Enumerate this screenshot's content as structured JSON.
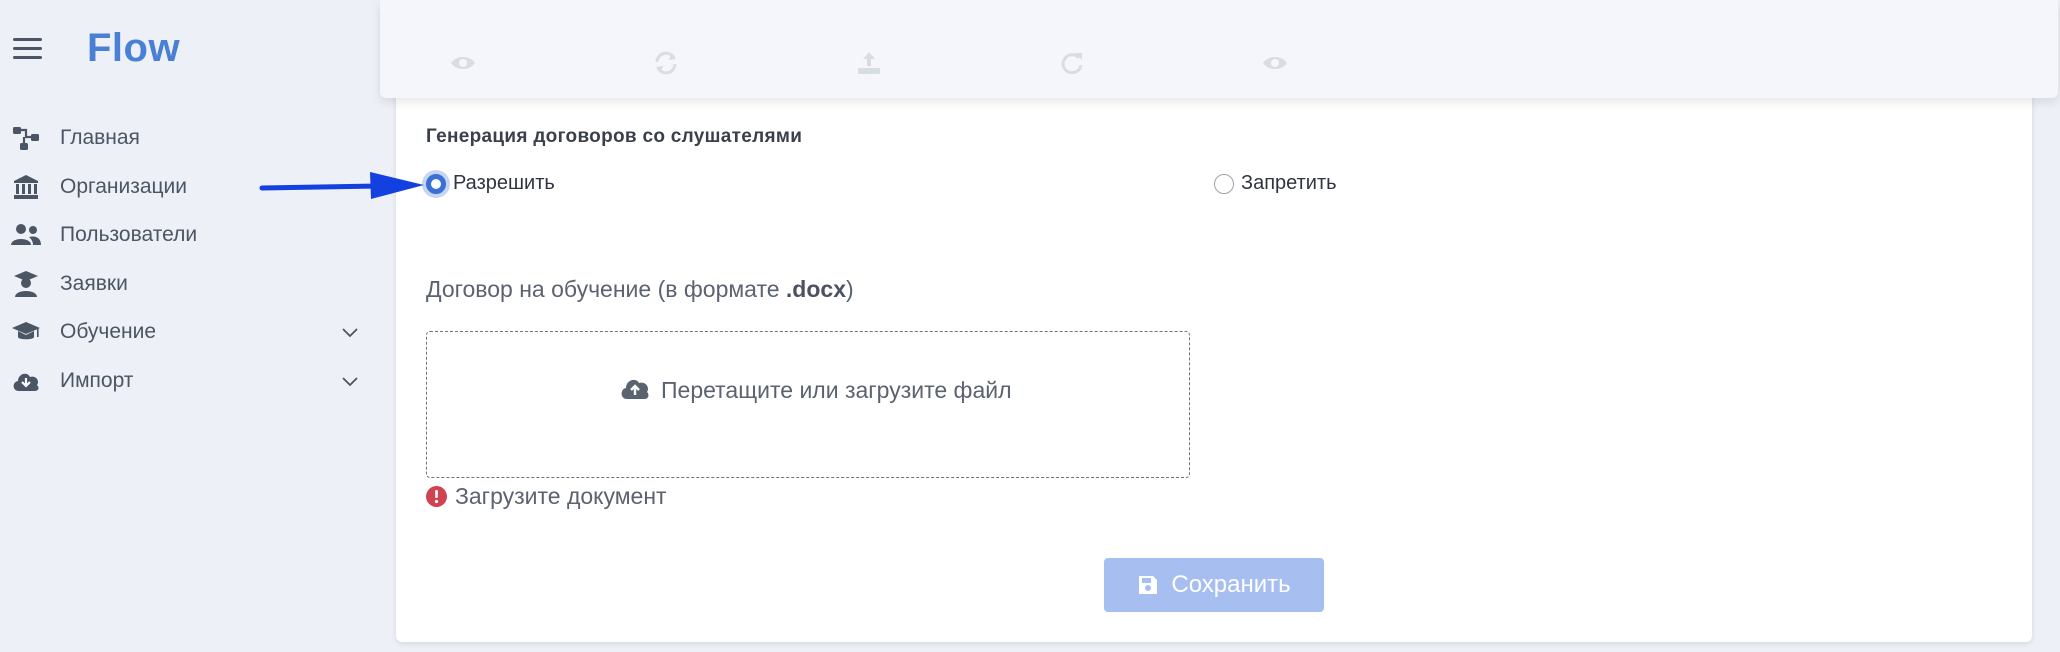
{
  "app": {
    "brand": "Flow"
  },
  "sidebar": {
    "items": [
      {
        "label": "Главная",
        "icon": "sitemap-icon",
        "has_chevron": false
      },
      {
        "label": "Организации",
        "icon": "bank-icon",
        "has_chevron": false
      },
      {
        "label": "Пользователи",
        "icon": "users-icon",
        "has_chevron": false
      },
      {
        "label": "Заявки",
        "icon": "graduate-icon",
        "has_chevron": false
      },
      {
        "label": "Обучение",
        "icon": "graduation-cap-icon",
        "has_chevron": true
      },
      {
        "label": "Импорт",
        "icon": "cloud-download-icon",
        "has_chevron": true
      }
    ]
  },
  "form": {
    "section_title": "Генерация договоров со слушателями",
    "radio_options": [
      {
        "label": "Разрешить",
        "checked": true
      },
      {
        "label": "Запретить",
        "checked": false
      }
    ],
    "doc_label_prefix": "Договор на обучение (в формате ",
    "doc_label_ext": ".docx",
    "doc_label_suffix": ")",
    "dropzone_text": "Перетащите или загрузите файл",
    "error_text": "Загрузите документ",
    "save_label": "Сохранить"
  },
  "colors": {
    "accent": "#3b6fd3",
    "brand": "#4a7fd6",
    "save_disabled": "#a7bff0",
    "error": "#d04452",
    "arrow": "#1340e0"
  }
}
